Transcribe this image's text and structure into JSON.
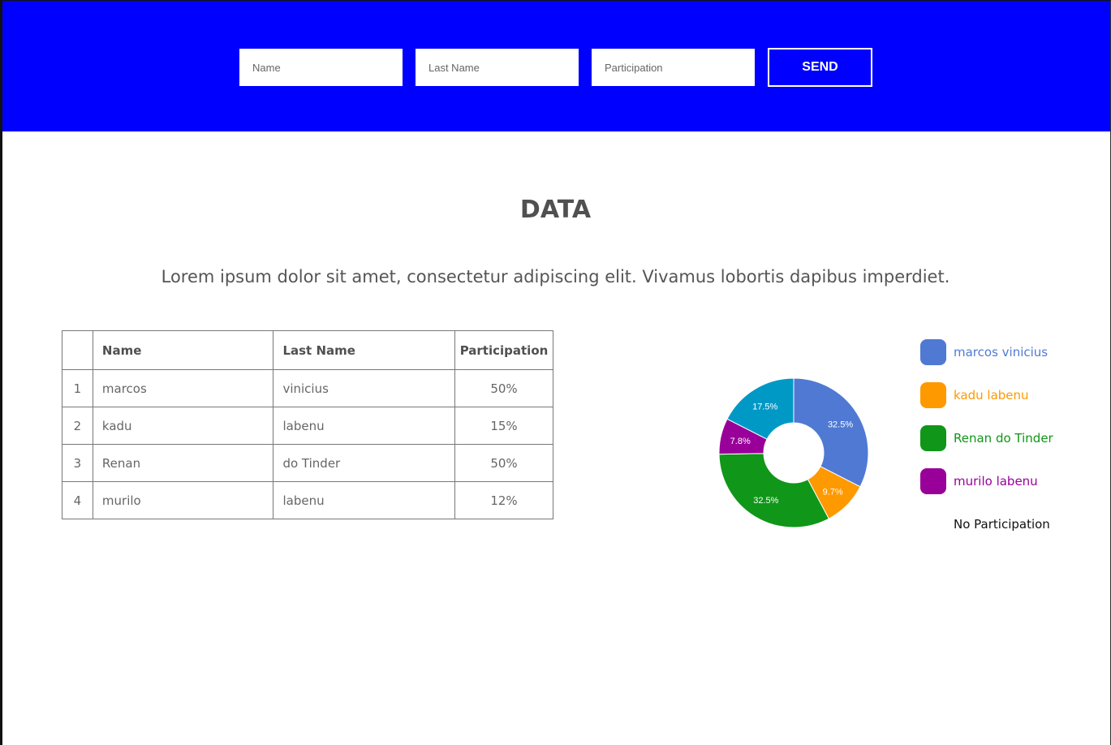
{
  "header": {
    "name_placeholder": "Name",
    "lastname_placeholder": "Last Name",
    "participation_placeholder": "Participation",
    "send_label": "SEND",
    "background_color": "#0000ff"
  },
  "main": {
    "title": "DATA",
    "subtitle": "Lorem ipsum dolor sit amet, consectetur adipiscing elit. Vivamus lobortis dapibus imperdiet."
  },
  "table": {
    "headers": [
      "",
      "Name",
      "Last Name",
      "Participation"
    ],
    "rows": [
      [
        "1",
        "marcos",
        "vinicius",
        "50%"
      ],
      [
        "2",
        "kadu",
        "labenu",
        "15%"
      ],
      [
        "3",
        "Renan",
        "do Tinder",
        "50%"
      ],
      [
        "4",
        "murilo",
        "labenu",
        "12%"
      ]
    ]
  },
  "chart_data": {
    "type": "pie",
    "donut": true,
    "series": [
      {
        "name": "marcos vinicius",
        "value": 32.5,
        "label": "32.5%",
        "color": "#5079d4"
      },
      {
        "name": "kadu labenu",
        "value": 9.7,
        "label": "9.7%",
        "color": "#ff9900"
      },
      {
        "name": "Renan do Tinder",
        "value": 32.5,
        "label": "32.5%",
        "color": "#109618"
      },
      {
        "name": "murilo labenu",
        "value": 7.8,
        "label": "7.8%",
        "color": "#990099"
      },
      {
        "name": "No Participation",
        "value": 17.5,
        "label": "17.5%",
        "color": "#0099c6"
      }
    ],
    "legend": [
      {
        "label": "marcos vinicius",
        "color": "#5079d4",
        "swatch": true
      },
      {
        "label": "kadu labenu",
        "color": "#ff9900",
        "swatch": true
      },
      {
        "label": "Renan do Tinder",
        "color": "#109618",
        "swatch": true
      },
      {
        "label": "murilo labenu",
        "color": "#990099",
        "swatch": true
      },
      {
        "label": "No Participation",
        "color": "#111111",
        "swatch": false
      }
    ],
    "legend_position": "right"
  }
}
